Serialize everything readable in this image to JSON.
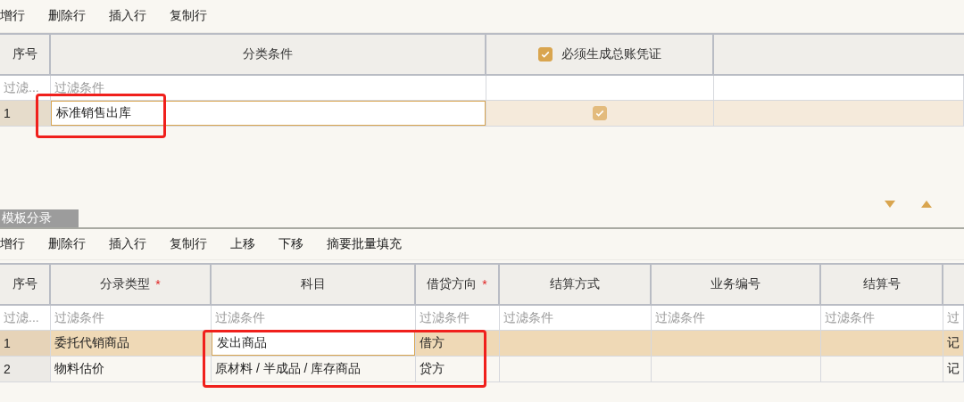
{
  "top_toolbar": [
    "增行",
    "删除行",
    "插入行",
    "复制行"
  ],
  "top_table": {
    "columns": [
      {
        "label": "序号",
        "kind": "text"
      },
      {
        "label": "分类条件",
        "kind": "text"
      },
      {
        "label": "必须生成总账凭证",
        "kind": "checkbox",
        "checked": true
      },
      {
        "kind": "empty"
      }
    ],
    "filters": [
      "过滤...",
      "过滤条件"
    ],
    "rows": [
      {
        "selected": true,
        "cells": [
          {
            "kind": "text",
            "text": "1",
            "editing": false
          },
          {
            "kind": "text",
            "text": "标准销售出库",
            "editing": true
          },
          {
            "kind": "checkbox",
            "checked": true,
            "editing": false
          },
          {
            "kind": "empty",
            "editing": false
          }
        ]
      }
    ]
  },
  "tab": {
    "label": "模板分录",
    "selected": true
  },
  "bottom_toolbar": [
    "增行",
    "删除行",
    "插入行",
    "复制行",
    "上移",
    "下移",
    "摘要批量填充"
  ],
  "bottom_table": {
    "columns": [
      {
        "label": "序号"
      },
      {
        "label": "分录类型",
        "required_mark": "*"
      },
      {
        "label": "科目"
      },
      {
        "label": "借贷方向",
        "required_mark": "*"
      },
      {
        "label": "结算方式"
      },
      {
        "label": "业务编号"
      },
      {
        "label": "结算号"
      },
      {
        "kind": "empty"
      }
    ],
    "filters": [
      "过滤...",
      "过滤条件",
      "过滤条件",
      "过滤条件",
      "过滤条件",
      "过滤条件",
      "过滤条件",
      "过"
    ],
    "rows": [
      {
        "selected": true,
        "cells": [
          {
            "kind": "text",
            "text": "1",
            "editing": false
          },
          {
            "kind": "text",
            "text": "委托代销商品",
            "editing": false
          },
          {
            "kind": "text",
            "text": "发出商品",
            "editing": true
          },
          {
            "kind": "text",
            "text": "借方",
            "editing": false
          },
          {
            "kind": "empty",
            "editing": false
          },
          {
            "kind": "empty",
            "editing": false
          },
          {
            "kind": "empty",
            "editing": false
          },
          {
            "kind": "text",
            "text": "记",
            "editing": false
          }
        ]
      },
      {
        "selected": false,
        "cells": [
          {
            "kind": "text",
            "text": "2",
            "editing": false
          },
          {
            "kind": "text",
            "text": "物料估价",
            "editing": false
          },
          {
            "kind": "text",
            "text": "原材料 / 半成品 / 库存商品",
            "editing": false
          },
          {
            "kind": "text",
            "text": "贷方",
            "editing": false
          },
          {
            "kind": "empty",
            "editing": false
          },
          {
            "kind": "empty",
            "editing": false
          },
          {
            "kind": "empty",
            "editing": false
          },
          {
            "kind": "text",
            "text": "记",
            "editing": false
          }
        ]
      }
    ]
  }
}
